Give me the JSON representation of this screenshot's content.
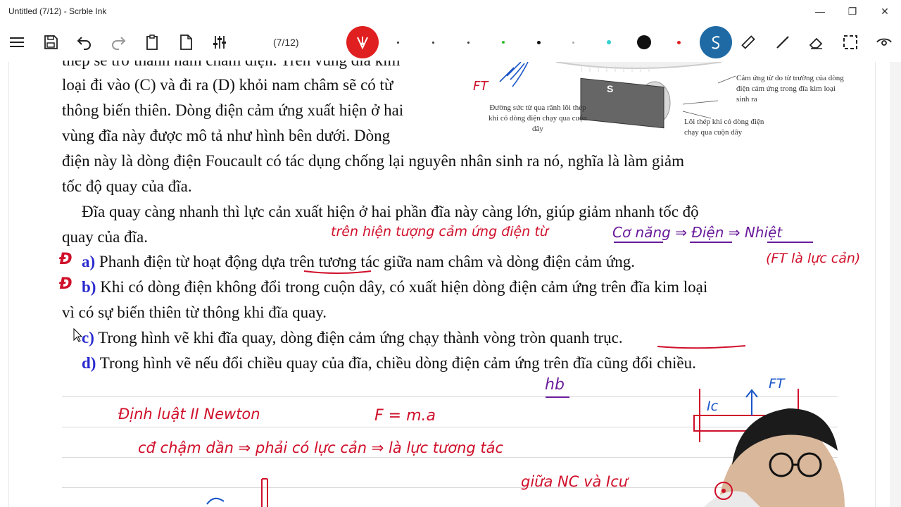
{
  "window": {
    "title": "Untitled (7/12) - Scrble Ink",
    "minimize": "—",
    "restore": "❐",
    "close": "✕"
  },
  "toolbar": {
    "page_indicator": "(7/12)",
    "icons": [
      "menu-icon",
      "save-icon",
      "undo-icon",
      "redo-icon",
      "clipboard-icon",
      "page-icon",
      "settings-sliders-icon",
      "pen-icon",
      "lasso-icon",
      "ruler-icon",
      "line-icon",
      "eraser-icon",
      "selection-icon",
      "view-icon"
    ],
    "pen_color": "#e02020",
    "select_color": "#1f6aa5"
  },
  "document": {
    "line1": "thép sẽ trở thành nam châm điện. Trên vùng đĩa kim",
    "line2": "loại đi vào (C) và đi ra (D) khỏi nam châm sẽ có từ",
    "line3": "thông biến thiên. Dòng điện cảm ứng xuất hiện ở hai",
    "line4": "vùng đĩa này được mô tả như hình bên dưới. Dòng",
    "line5": "điện này là dòng điện Foucault có tác dụng chống lại nguyên nhân sinh ra nó, nghĩa là làm giảm",
    "line6": "tốc độ quay của đĩa.",
    "line7": "Đĩa quay càng nhanh thì lực cản xuất hiện ở hai phần đĩa này càng lớn, giúp giảm nhanh tốc độ",
    "line8": "quay của đĩa.",
    "a_label": "a)",
    "a_text": "Phanh điện từ hoạt động dựa trên tương tác giữa nam châm và dòng điện cảm ứng.",
    "b_label": "b)",
    "b_text": "Khi có dòng điện không đổi trong cuộn dây, có xuất hiện dòng điện cảm ứng trên đĩa kim loại",
    "b_text2": "vì có sự biến thiên từ thông khi đĩa quay.",
    "c_label": "c)",
    "c_text": "Trong hình vẽ khi đĩa quay, dòng điện cảm ứng chạy thành vòng tròn quanh trục.",
    "d_label": "d)",
    "d_text": "Trong hình vẽ nếu đổi chiều quay của đĩa, chiều dòng điện cảm ứng trên đĩa cũng đổi chiều."
  },
  "figure": {
    "caption1": "Đường sức từ qua rãnh lõi thép khi có dòng điện chạy qua cuộn dây",
    "caption2": "Cảm ứng từ do từ trường của dòng điện cảm ứng trong đĩa kim loại sinh ra",
    "caption3": "Lõi thép khi có dòng điện chạy qua cuộn dây",
    "magnet_label": "S",
    "ft_label": "FT"
  },
  "annotations": {
    "tren_hien_tuong": "trên hiện tượng cảm ứng điện từ",
    "energy_chain": "Cơ năng ⇒ Điện ⇒ Nhiệt",
    "a_mark": "Đ",
    "b_mark": "Đ",
    "ft_note": "(FT là lực cản)",
    "hb": "hb",
    "newton": "Định luật II Newton",
    "formula": "F = m.a",
    "cd_cham_dan": "cđ chậm dần ⇒ phải có lực cản ⇒ là lực tương tác",
    "giua_nc": "giữa NC và Icư",
    "ic_label": "Ic",
    "ft_right": "FT"
  }
}
